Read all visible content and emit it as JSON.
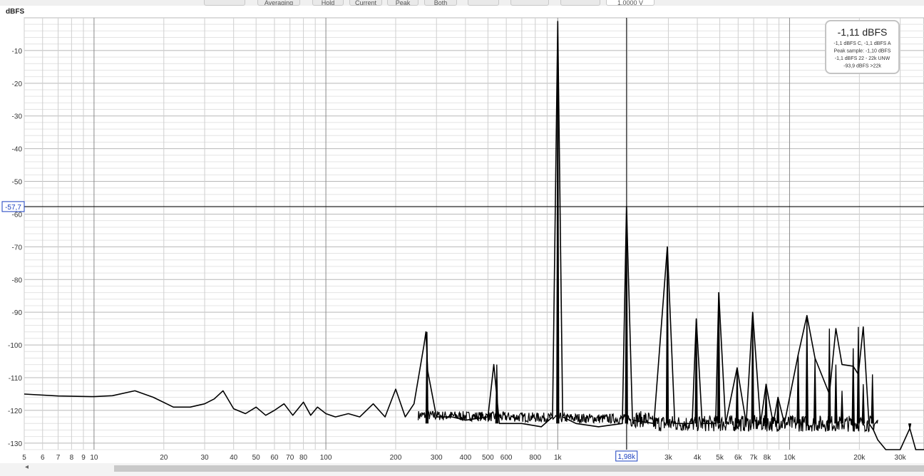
{
  "toolbar": {
    "buttons": [
      "",
      "Averaging",
      "Hold",
      "Current",
      "Peak",
      "Both",
      "",
      "",
      ""
    ],
    "voltage": "1,0000 V"
  },
  "chart_data": {
    "type": "line",
    "title": "",
    "ylabel": "dBFS",
    "xlabel": "",
    "xscale": "log",
    "xlim": [
      5,
      38000
    ],
    "ylim": [
      -132,
      0
    ],
    "grid": true,
    "y_ticks": [
      -10,
      -20,
      -30,
      -40,
      -50,
      -60,
      -70,
      -80,
      -90,
      -100,
      -110,
      -120,
      -130
    ],
    "y_tick_labels": [
      "-10",
      "-20",
      "-30",
      "-40",
      "-50",
      "-60",
      "-70",
      "-80",
      "-90",
      "-100",
      "-110",
      "-120",
      "-130"
    ],
    "x_ticks": [
      5,
      6,
      7,
      8,
      9,
      10,
      20,
      30,
      40,
      50,
      60,
      70,
      80,
      100,
      200,
      300,
      400,
      500,
      600,
      800,
      1000,
      3000,
      4000,
      5000,
      6000,
      7000,
      8000,
      10000,
      20000,
      30000
    ],
    "x_tick_labels": [
      "5",
      "6",
      "7",
      "8",
      "9",
      "10",
      "20",
      "30",
      "40",
      "50",
      "60",
      "70",
      "80",
      "100",
      "200",
      "300",
      "400",
      "500",
      "600",
      "800",
      "1k",
      "3k",
      "4k",
      "5k",
      "6k",
      "7k",
      "8k",
      "10k",
      "20k",
      "30k"
    ],
    "cursor": {
      "x": 1980,
      "y": -57.7,
      "x_label": "1,98k",
      "y_label": "-57,7"
    },
    "series": [
      {
        "x": [
          5,
          7,
          10,
          12,
          15,
          18,
          22,
          26,
          30,
          33,
          36,
          40,
          45,
          50,
          55,
          60,
          66,
          72,
          80,
          86,
          92,
          100,
          110,
          125,
          140,
          160,
          180,
          200,
          220,
          240,
          265,
          270,
          275,
          300,
          350,
          400,
          500,
          530,
          560,
          700,
          850,
          950,
          1000,
          1050,
          1200,
          1500,
          1900,
          1980,
          2100,
          2600,
          2970,
          3200,
          3800,
          3960,
          4200,
          4800,
          4950,
          5300,
          5940,
          6500,
          6930,
          7500,
          7920,
          8500,
          8910,
          9500,
          10890,
          11880,
          12870,
          14850,
          15840,
          16830,
          18810,
          19800,
          20790,
          22000,
          23000,
          24000,
          26000,
          30000,
          33000,
          35000,
          38000
        ],
        "values": [
          -115,
          -115.6,
          -115.8,
          -115.5,
          -114,
          -116,
          -119,
          -119,
          -118,
          -116.5,
          -114,
          -119.5,
          -121,
          -119,
          -121.5,
          -120,
          -118,
          -121.5,
          -117.5,
          -121.5,
          -119,
          -121,
          -122,
          -121,
          -122,
          -118,
          -122,
          -113.5,
          -122,
          -118,
          -100,
          -96,
          -108,
          -122,
          -122,
          -123,
          -122,
          -106,
          -124,
          -124,
          -125,
          -122,
          -1.1,
          -122,
          -124,
          -125,
          -124,
          -57.7,
          -123,
          -124,
          -70,
          -124,
          -124,
          -92,
          -124,
          -124,
          -84,
          -124,
          -107,
          -124,
          -90,
          -124,
          -112,
          -124,
          -116,
          -124,
          -103,
          -91,
          -104,
          -115,
          -95,
          -106,
          -106.5,
          -109,
          -94.5,
          -124,
          -126,
          -129,
          -132,
          -132,
          -125.5,
          -132,
          -132
        ],
        "peaks": [
          {
            "x": 273,
            "y": -96
          },
          {
            "x": 546,
            "y": -106
          },
          {
            "x": 1000,
            "y": -1.1
          },
          {
            "x": 1980,
            "y": -57.7
          },
          {
            "x": 2970,
            "y": -70
          },
          {
            "x": 3960,
            "y": -92
          },
          {
            "x": 4950,
            "y": -84
          },
          {
            "x": 5940,
            "y": -107
          },
          {
            "x": 6930,
            "y": -90
          },
          {
            "x": 7920,
            "y": -112
          },
          {
            "x": 8910,
            "y": -116
          },
          {
            "x": 10890,
            "y": -103
          },
          {
            "x": 11880,
            "y": -91
          },
          {
            "x": 12870,
            "y": -104
          },
          {
            "x": 14850,
            "y": -95
          },
          {
            "x": 15840,
            "y": -106
          },
          {
            "x": 16830,
            "y": -114
          },
          {
            "x": 18810,
            "y": -101
          },
          {
            "x": 19800,
            "y": -94.5
          },
          {
            "x": 20790,
            "y": -112
          },
          {
            "x": 22770,
            "y": -109
          },
          {
            "x": 33000,
            "y": -125.5
          }
        ]
      }
    ]
  },
  "readout": {
    "main": "-1,11 dBFS",
    "lines": [
      "-1,1 dBFS C, -1,1 dBFS A",
      "Peak sample: -1,10 dBFS",
      "-1,1 dBFS 22 - 22k UNW",
      "-93,9 dBFS >22k"
    ]
  },
  "colors": {
    "trace": "#000000",
    "grid_minor": "#e4e4e4",
    "grid_major": "#8a8a8a",
    "cursor": "#000000",
    "cursor_label": "#1a3fbf"
  }
}
